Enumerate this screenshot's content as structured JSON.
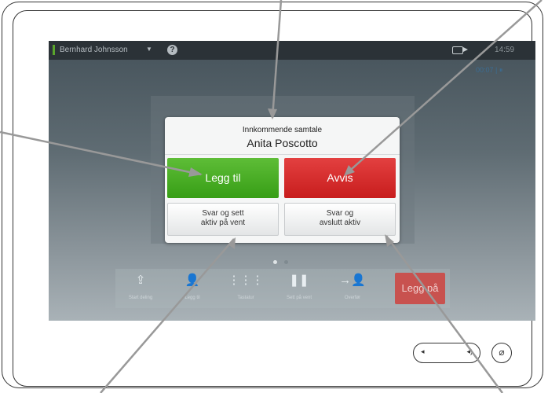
{
  "status_bar": {
    "user_name": "Bernhard Johnsson",
    "dropdown_caret": "▼",
    "help_glyph": "?",
    "camera_icon": "camera-icon",
    "clock": "14:59",
    "call_timer": "00:07 | ⏸"
  },
  "incoming_call": {
    "subtitle": "Innkommende samtale",
    "caller": "Anita Poscotto",
    "add_label": "Legg til",
    "reject_label": "Avvis",
    "answer_hold_label_line1": "Svar og sett",
    "answer_hold_label_line2": "aktiv på vent",
    "answer_end_label_line1": "Svar og",
    "answer_end_label_line2": "avslutt aktiv"
  },
  "toolbar": {
    "items": [
      {
        "label": "Start deling",
        "icon": "share-icon",
        "glyph": "⇪"
      },
      {
        "label": "Legg til",
        "icon": "add-participant-icon",
        "glyph": "👤"
      },
      {
        "label": "Tastatur",
        "icon": "keypad-icon",
        "glyph": "⋮⋮⋮"
      },
      {
        "label": "Sett på vent",
        "icon": "pause-icon",
        "glyph": "❚❚"
      },
      {
        "label": "Overfør",
        "icon": "transfer-icon",
        "glyph": "→👤"
      }
    ],
    "hangup_label": "Legg på"
  },
  "page_indicator": {
    "pages": 2,
    "active": 1
  },
  "hardware": {
    "volume_down_icon": "volume-down-icon",
    "volume_up_icon": "volume-up-icon",
    "mute_icon": "microphone-mute-icon"
  },
  "colors": {
    "accept_green": "#3fa41d",
    "reject_red": "#d12a2a",
    "hangup_red": "#c8524f",
    "presence_green": "#5aa52c"
  }
}
